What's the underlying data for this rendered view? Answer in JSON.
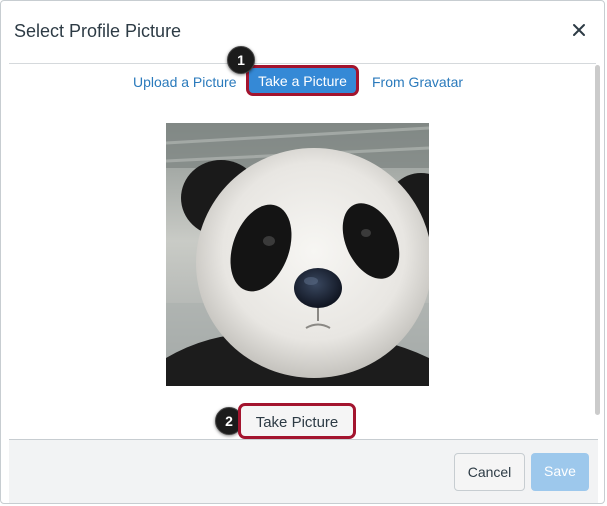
{
  "dialog": {
    "title": "Select Profile Picture",
    "close_icon": "close-icon",
    "tabs": [
      {
        "label": "Upload a Picture",
        "active": false
      },
      {
        "label": "Take a Picture",
        "active": true
      },
      {
        "label": "From Gravatar",
        "active": false
      }
    ],
    "take_picture_label": "Take Picture",
    "footer": {
      "cancel_label": "Cancel",
      "save_label": "Save"
    }
  },
  "callouts": [
    "1",
    "2"
  ],
  "colors": {
    "link": "#2a7abc",
    "active_tab": "#3589d6",
    "highlight_border": "#a3142e",
    "save_disabled": "#9dc8ec"
  }
}
